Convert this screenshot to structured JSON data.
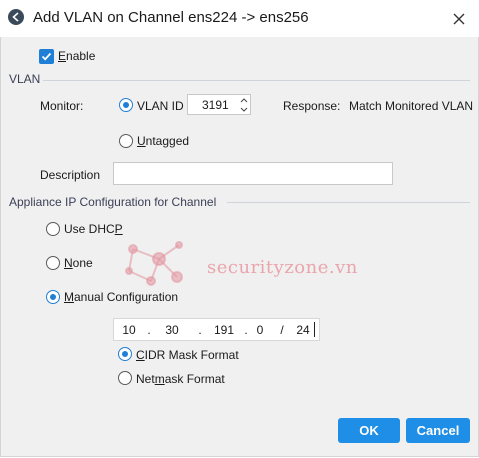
{
  "window": {
    "title": "Add VLAN on Channel ens224 -> ens256",
    "icon": "app-icon",
    "close_icon": "close-icon"
  },
  "enable": {
    "label_mnemonic": "E",
    "label_rest": "nable",
    "checked": true
  },
  "vlan_section": {
    "title": "VLAN",
    "monitor_label": "Monitor:",
    "vlan_id_label": "VLAN ID",
    "vlan_id_value": "3191",
    "vlan_id_selected": true,
    "response_label": "Response:",
    "response_value": "Match Monitored VLAN",
    "untagged_mnemonic": "U",
    "untagged_rest": "ntagged",
    "description_label": "Description",
    "description_value": ""
  },
  "ip_section": {
    "title": "Appliance IP Configuration for Channel",
    "options": {
      "dhcp_pre": "Use DHC",
      "dhcp_mnemonic": "P",
      "none_mnemonic": "N",
      "none_rest": "one",
      "manual_mnemonic": "M",
      "manual_rest": "anual Configuration"
    },
    "selected_option": "Manual Configuration",
    "ip": {
      "o1": "10",
      "o2": "30",
      "o3": "191",
      "o4": "0",
      "prefix": "24",
      "dot": ".",
      "slash": "/"
    },
    "format_options": {
      "cidr_mnemonic": "C",
      "cidr_rest": "IDR Mask Format",
      "netmask_pre": "Net",
      "netmask_mnemonic": "m",
      "netmask_rest": "ask Format"
    },
    "selected_format": "CIDR Mask Format"
  },
  "buttons": {
    "ok": "OK",
    "cancel": "Cancel"
  },
  "watermark": {
    "text": "securityzone.vn"
  },
  "colors": {
    "accent": "#1f7fd6",
    "button": "#1f8ee6",
    "watermark": "#e88c96"
  }
}
